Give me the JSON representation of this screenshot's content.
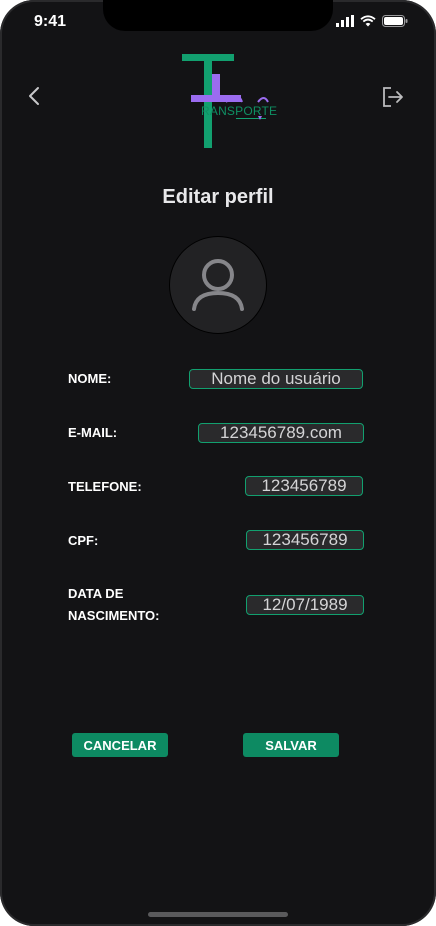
{
  "status": {
    "time": "9:41"
  },
  "logo": {
    "text": "RANSPORTE"
  },
  "page": {
    "title": "Editar perfil"
  },
  "form": {
    "name_label": "NOME:",
    "name_value": "Nome do usuário",
    "email_label": "E-MAIL:",
    "email_value": "123456789.com",
    "phone_label": "TELEFONE:",
    "phone_value": "123456789",
    "cpf_label": "CPF:",
    "cpf_value": "123456789",
    "birth_label_line1": "DATA DE",
    "birth_label_line2": "NASCIMENTO:",
    "birth_value": "12/07/1989"
  },
  "actions": {
    "cancel_label": "CANCELAR",
    "save_label": "SALVAR"
  },
  "colors": {
    "background": "#131315",
    "accent": "#0d8a62",
    "logo_purple": "#9b6cf0"
  }
}
